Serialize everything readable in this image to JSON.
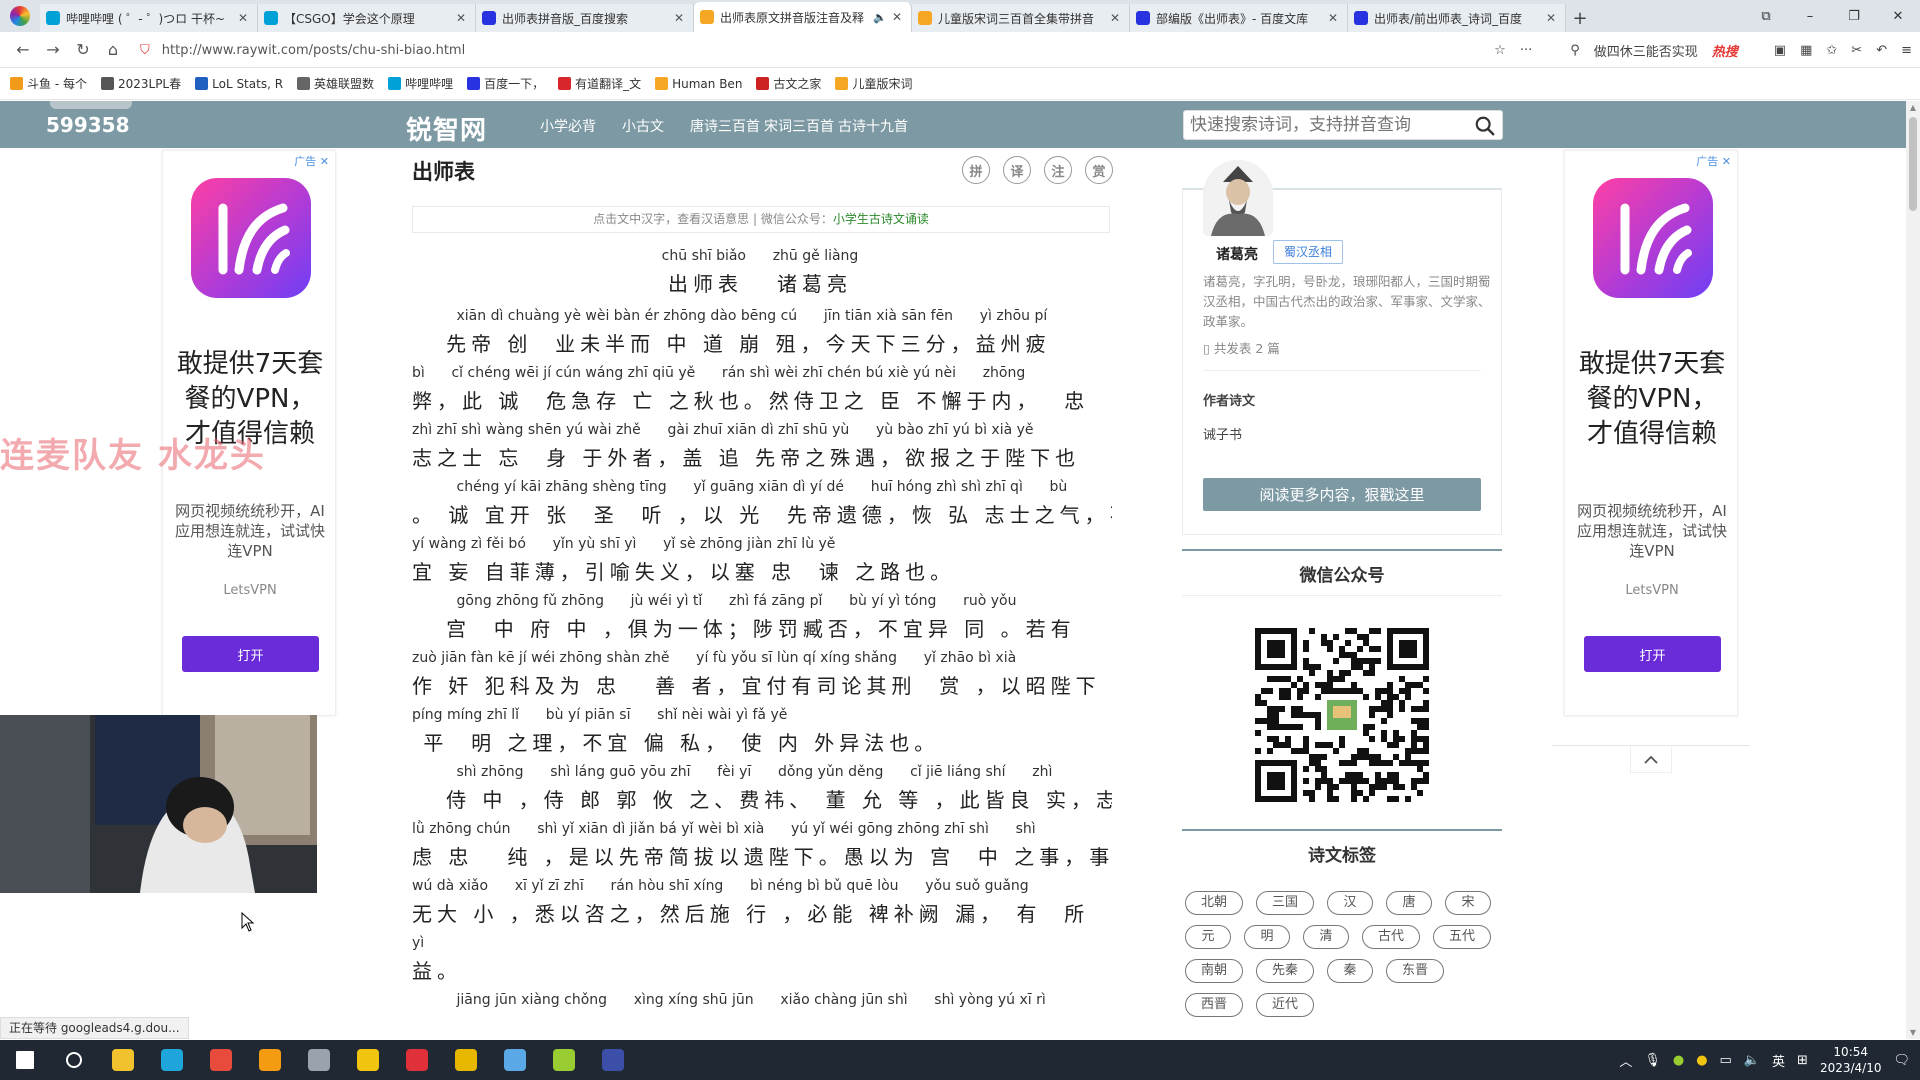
{
  "browser": {
    "tabs": [
      {
        "title": "哔哩哔哩 ( ゜- ゜)つロ 干杯~",
        "color": "#00a1d6",
        "active": false
      },
      {
        "title": "【CSGO】学会这个原理",
        "color": "#00a1d6",
        "active": false
      },
      {
        "title": "出师表拼音版_百度搜索",
        "color": "#2932e1",
        "active": false
      },
      {
        "title": "出师表原文拼音版注音及释",
        "color": "#f5a623",
        "active": true
      },
      {
        "title": "儿童版宋词三百首全集带拼音",
        "color": "#f5a623",
        "active": false
      },
      {
        "title": "部编版《出师表》- 百度文库",
        "color": "#2932e1",
        "active": false
      },
      {
        "title": "出师表/前出师表_诗词_百度",
        "color": "#2932e1",
        "active": false
      }
    ],
    "url": "http://www.raywit.com/posts/chu-shi-biao.html",
    "right_search_text": "做四休三能否实现",
    "hot_label": "热搜",
    "bookmarks": [
      {
        "label": "斗鱼 - 每个",
        "color": "#f29a1c"
      },
      {
        "label": "2023LPL春",
        "color": "#555555"
      },
      {
        "label": "LoL Stats, R",
        "color": "#1f5fbf"
      },
      {
        "label": "英雄联盟数",
        "color": "#666666"
      },
      {
        "label": "哔哩哔哩",
        "color": "#00a1d6"
      },
      {
        "label": "百度一下，",
        "color": "#2932e1"
      },
      {
        "label": "有道翻译_文",
        "color": "#d8262d"
      },
      {
        "label": "Human Ben",
        "color": "#f5a623"
      },
      {
        "label": "古文之家",
        "color": "#cc2222"
      },
      {
        "label": "儿童版宋词",
        "color": "#f5a623"
      }
    ]
  },
  "site": {
    "counter": "599358",
    "logo": "锐智网",
    "nav": [
      "小学必背",
      "小古文",
      "唐诗三百首",
      "宋词三百首",
      "古诗十九首"
    ],
    "search_placeholder": "快速搜索诗词，支持拼音查询"
  },
  "ad": {
    "tag": "广告",
    "headline": "敢提供7天套餐的VPN，才值得信赖",
    "desc": "网页视频统统秒开，AI应用想连就连，试试快连VPN",
    "brand": "LetsVPN",
    "button": "打开"
  },
  "article": {
    "title": "出师表",
    "tools": [
      "拼",
      "译",
      "注",
      "赏"
    ],
    "hint": "点击文中汉字，查看汉语意思 | 微信公众号：",
    "hint_link": "小学生古诗文诵读",
    "title_pinyin": "chū shī biǎo      zhū gě liàng",
    "title_hanzi": "出师表   诸葛亮",
    "lines": [
      {
        "py": "          xiān dì chuàng yè wèi bàn ér zhōng dào bēng cú      jīn tiān xià sān fēn      yì zhōu pí",
        "hz": "   先帝 创  业未半而 中 道 崩 殂，今天下三分，益州疲"
      },
      {
        "py": "bì      cǐ chéng wēi jí cún wáng zhī qiū yě      rán shì wèi zhī chén bú xiè yú nèi      zhōng",
        "hz": "弊，此 诚  危急存 亡 之秋也。然侍卫之 臣 不懈于内，  忠"
      },
      {
        "py": "zhì zhī shì wàng shēn yú wài zhě      gài zhuī xiān dì zhī shū yù      yù bào zhī yú bì xià yě",
        "hz": "志之士 忘  身 于外者，盖 追 先帝之殊遇，欲报之于陛下也"
      },
      {
        "py": "          chéng yí kāi zhāng shèng tīng      yǐ guāng xiān dì yí dé      huī hóng zhì shì zhī qì      bù",
        "hz": "。 诚 宜开 张  圣  听 ，以 光  先帝遗德，恢 弘 志士之气，不"
      },
      {
        "py": "yí wàng zì fěi bó      yǐn yù shī yì      yǐ sè zhōng jiàn zhī lù yě",
        "hz": "宜 妄 自菲薄，引喻失义，以塞 忠  谏 之路也。"
      },
      {
        "py": "          gōng zhōng fǔ zhōng      jù wéi yì tǐ      zhì fá zāng pǐ      bù yí yì tóng      ruò yǒu",
        "hz": "   宫  中 府 中 ，俱为一体；陟罚臧否，不宜异 同 。若有"
      },
      {
        "py": "zuò jiān fàn kē jí wéi zhōng shàn zhě      yí fù yǒu sī lùn qí xíng shǎng      yǐ zhāo bì xià",
        "hz": "作 奸 犯科及为 忠   善 者，宜付有司论其刑  赏 ，以昭陛下"
      },
      {
        "py": "píng míng zhī lǐ      bù yí piān sī      shǐ nèi wài yì fǎ yě",
        "hz": " 平  明 之理，不宜 偏 私， 使 内 外异法也。"
      },
      {
        "py": "          shì zhōng      shì láng guō yōu zhī      fèi yī      dǒng yǔn děng      cǐ jiē liáng shí      zhì",
        "hz": "   侍 中 ，侍 郎 郭 攸 之、费祎、 董 允 等 ，此皆良 实，志"
      },
      {
        "py": "lǜ zhōng chún      shì yǐ xiān dì jiǎn bá yǐ wèi bì xià      yú yǐ wéi gōng zhōng zhī shì      shì",
        "hz": "虑 忠   纯 ，是以先帝简拔以遗陛下。愚以为 宫  中 之事，事"
      },
      {
        "py": "wú dà xiǎo      xī yǐ zī zhī      rán hòu shī xíng      bì néng bì bǔ quē lòu      yǒu suǒ guǎng",
        "hz": "无大 小 ，悉以咨之，然后施 行 ，必能 裨补阙 漏， 有  所  广"
      },
      {
        "py": "yì",
        "hz": "益。"
      },
      {
        "py": "          jiāng jūn xiàng chǒng      xìng xíng shū jūn      xiǎo chàng jūn shì      shì yòng yú xī rì",
        "hz": ""
      }
    ]
  },
  "author": {
    "name": "诸葛亮",
    "dynasty": "蜀汉丞相",
    "bio": "诸葛亮，字孔明，号卧龙，琅琊阳都人，三国时期蜀汉丞相，中国古代杰出的政治家、军事家、文学家、政革家。",
    "count": "共发表 2 篇",
    "works_title": "作者诗文",
    "works": [
      "诫子书"
    ],
    "read_more": "阅读更多内容，狠戳这里"
  },
  "wechat_title": "微信公众号",
  "tags_title": "诗文标签",
  "tags": [
    "北朝",
    "三国",
    "汉",
    "唐",
    "宋",
    "元",
    "明",
    "清",
    "古代",
    "五代",
    "南朝",
    "先秦",
    "秦",
    "东晋",
    "西晋",
    "近代"
  ],
  "overlay": {
    "danmaku": "连麦队友 水龙头",
    "status": "正在等待 googleads4.g.dou..."
  },
  "taskbar": {
    "icons": [
      {
        "name": "start",
        "color": "#ffffff"
      },
      {
        "name": "search",
        "color": "#ffffff"
      },
      {
        "name": "explorer",
        "color": "#f2c12e"
      },
      {
        "name": "edge",
        "color": "#1ea5d9"
      },
      {
        "name": "browser",
        "color": "#e84a3c"
      },
      {
        "name": "app-orange",
        "color": "#f39c12"
      },
      {
        "name": "app-gray",
        "color": "#9aa3ad"
      },
      {
        "name": "app-obs",
        "color": "#f1c40f"
      },
      {
        "name": "netease-music",
        "color": "#e0303a"
      },
      {
        "name": "app-owl",
        "color": "#e6b800"
      },
      {
        "name": "steam",
        "color": "#5aa9e6"
      },
      {
        "name": "app-green",
        "color": "#9acd32"
      },
      {
        "name": "app-se",
        "color": "#3b4fa8"
      }
    ],
    "ime": "英",
    "time": "10:54",
    "date": "2023/4/10"
  }
}
